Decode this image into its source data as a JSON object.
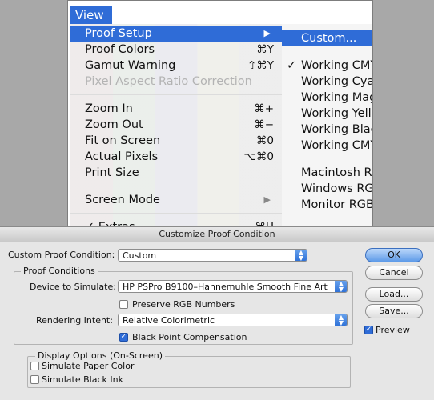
{
  "view_menu": {
    "title": "View",
    "items": [
      {
        "label": "Proof Setup",
        "shortcut": "",
        "submenu": true,
        "highlighted": true,
        "disabled": false
      },
      {
        "label": "Proof Colors",
        "shortcut": "⌘Y",
        "submenu": false,
        "highlighted": false,
        "disabled": false
      },
      {
        "label": "Gamut Warning",
        "shortcut": "⇧⌘Y",
        "submenu": false,
        "highlighted": false,
        "disabled": false
      },
      {
        "label": "Pixel Aspect Ratio Correction",
        "shortcut": "",
        "submenu": false,
        "highlighted": false,
        "disabled": true
      },
      {
        "label": "Zoom In",
        "shortcut": "⌘+",
        "submenu": false,
        "highlighted": false,
        "disabled": false
      },
      {
        "label": "Zoom Out",
        "shortcut": "⌘−",
        "submenu": false,
        "highlighted": false,
        "disabled": false
      },
      {
        "label": "Fit on Screen",
        "shortcut": "⌘0",
        "submenu": false,
        "highlighted": false,
        "disabled": false
      },
      {
        "label": "Actual Pixels",
        "shortcut": "⌥⌘0",
        "submenu": false,
        "highlighted": false,
        "disabled": false
      },
      {
        "label": "Print Size",
        "shortcut": "",
        "submenu": false,
        "highlighted": false,
        "disabled": false
      },
      {
        "label": "Screen Mode",
        "shortcut": "",
        "submenu": true,
        "highlighted": false,
        "disabled": false
      },
      {
        "label": "✓ Extras",
        "shortcut": "⌘H",
        "submenu": false,
        "highlighted": false,
        "disabled": false
      }
    ]
  },
  "proof_submenu": {
    "items": [
      {
        "label": "Custom...",
        "checked": false,
        "highlighted": true
      },
      {
        "label": "Working CMYK",
        "checked": true,
        "highlighted": false
      },
      {
        "label": "Working Cyan Plate",
        "checked": false,
        "highlighted": false
      },
      {
        "label": "Working Magenta Plate",
        "checked": false,
        "highlighted": false
      },
      {
        "label": "Working Yellow Plate",
        "checked": false,
        "highlighted": false
      },
      {
        "label": "Working Black Plate",
        "checked": false,
        "highlighted": false
      },
      {
        "label": "Working CMY Plates",
        "checked": false,
        "highlighted": false
      },
      {
        "label": "Macintosh RGB",
        "checked": false,
        "highlighted": false
      },
      {
        "label": "Windows RGB",
        "checked": false,
        "highlighted": false
      },
      {
        "label": "Monitor RGB",
        "checked": false,
        "highlighted": false
      }
    ]
  },
  "dialog": {
    "title": "Customize Proof Condition",
    "custom_condition_label": "Custom Proof Condition:",
    "custom_condition_value": "Custom",
    "proof_conditions_title": "Proof Conditions",
    "device_label": "Device to Simulate:",
    "device_value": "HP PSPro B9100–Hahnemuhle Smooth Fine Art",
    "preserve_rgb_label": "Preserve RGB Numbers",
    "rendering_label": "Rendering Intent:",
    "rendering_value": "Relative Colorimetric",
    "bpc_label": "Black Point Compensation",
    "display_options_title": "Display Options (On-Screen)",
    "paper_color_label": "Simulate Paper Color",
    "black_ink_label": "Simulate Black Ink",
    "ok_label": "OK",
    "cancel_label": "Cancel",
    "load_label": "Load...",
    "save_label": "Save...",
    "preview_label": "Preview",
    "preserve_rgb_checked": false,
    "bpc_checked": true,
    "paper_color_checked": false,
    "black_ink_checked": false,
    "preview_checked": true
  },
  "colors": {
    "highlight": "#2f6cd7",
    "dialog_bg": "#e6e6e6"
  }
}
